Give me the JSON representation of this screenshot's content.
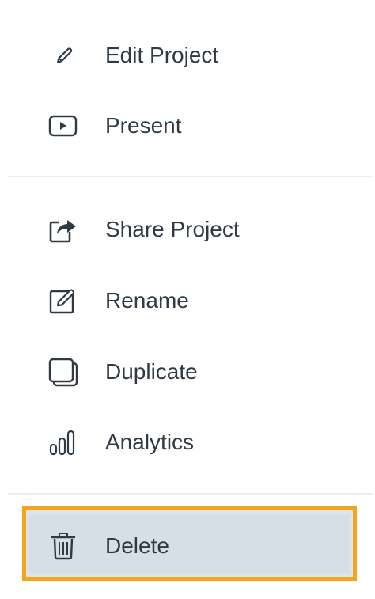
{
  "menu": {
    "items": [
      {
        "label": "Edit Project",
        "icon": "pencil-icon"
      },
      {
        "label": "Present",
        "icon": "play-icon"
      },
      {
        "label": "Share Project",
        "icon": "share-icon"
      },
      {
        "label": "Rename",
        "icon": "edit-box-icon"
      },
      {
        "label": "Duplicate",
        "icon": "duplicate-icon"
      },
      {
        "label": "Analytics",
        "icon": "bar-chart-icon"
      },
      {
        "label": "Delete",
        "icon": "trash-icon"
      }
    ],
    "highlight_color": "#f3a51e",
    "text_color": "#2f3a45",
    "icon_color": "#2f3a45",
    "highlighted_item": "Delete"
  }
}
